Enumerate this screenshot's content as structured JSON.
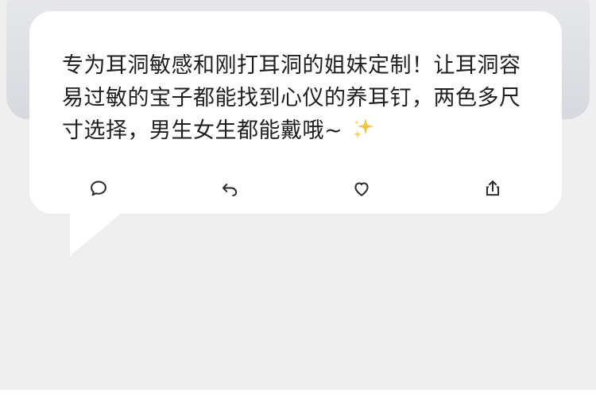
{
  "message": {
    "text": "专为耳洞敏感和刚打耳洞的姐妹定制！让耳洞容易过敏的宝子都能找到心仪的养耳钉，两色多尺寸选择，男生女生都能戴哦~"
  },
  "icons": {
    "sparkle": "sparkles-icon",
    "comment": "comment-icon",
    "reply": "reply-icon",
    "like": "heart-icon",
    "share": "share-icon"
  },
  "colors": {
    "background": "#efefef",
    "bubble": "#ffffff",
    "text": "#1f1f1f",
    "icon": "#2d2d2d",
    "sparkle": "#f4c542"
  }
}
